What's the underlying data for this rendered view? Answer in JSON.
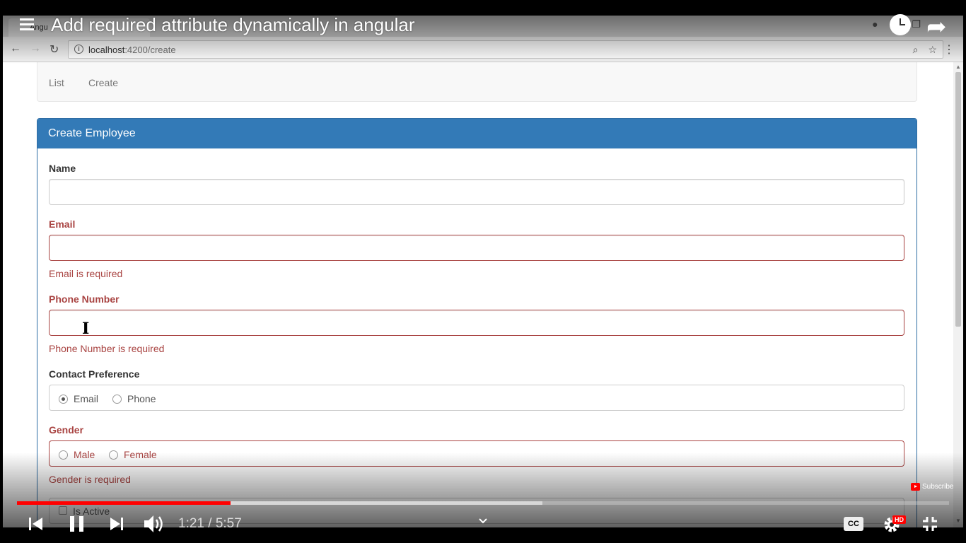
{
  "video": {
    "title": "Add required attribute dynamically in angular",
    "current_time": "1:21",
    "separator": " / ",
    "duration": "5:57",
    "played_fraction": 0.229,
    "buffered_fraction": 0.564,
    "subscribe_label": "Subscribe",
    "cc_label": "CC",
    "hd_label": "HD",
    "accent_color": "#ff0000"
  },
  "browser": {
    "tab_title": "Angu",
    "url_host": "localhost",
    "url_path": ":4200/create"
  },
  "app_nav": {
    "items": [
      {
        "label": "List"
      },
      {
        "label": "Create"
      }
    ]
  },
  "form": {
    "heading": "Create Employee",
    "heading_color": "#337ab7",
    "error_color": "#a94442",
    "name": {
      "label": "Name",
      "value": ""
    },
    "email": {
      "label": "Email",
      "value": "",
      "error": "Email is required"
    },
    "phone": {
      "label": "Phone Number",
      "value": "",
      "error": "Phone Number is required"
    },
    "contact_preference": {
      "label": "Contact Preference",
      "options": [
        "Email",
        "Phone"
      ],
      "selected": "Email"
    },
    "gender": {
      "label": "Gender",
      "options": [
        "Male",
        "Female"
      ],
      "selected": null,
      "error": "Gender is required"
    },
    "is_active": {
      "label": "Is Active",
      "checked": false
    }
  }
}
